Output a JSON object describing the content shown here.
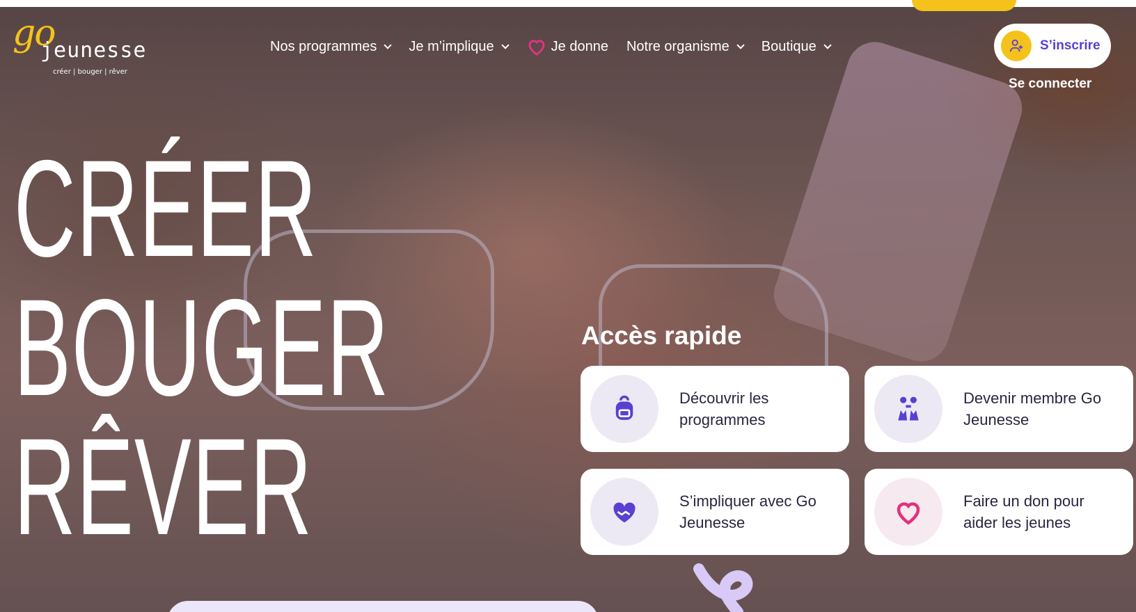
{
  "logo": {
    "go": "go",
    "name": "jeunesse",
    "tagline": "créer | bouger | rêver"
  },
  "nav": {
    "items": [
      {
        "label": "Nos programmes",
        "dropdown": true
      },
      {
        "label": "Je m’implique",
        "dropdown": true
      },
      {
        "label": "Je donne",
        "icon": "heart-icon",
        "dropdown": false
      },
      {
        "label": "Notre organisme",
        "dropdown": true
      },
      {
        "label": "Boutique",
        "dropdown": true
      }
    ]
  },
  "account": {
    "signup_label": "S’inscrire",
    "login_label": "Se connecter"
  },
  "hero": {
    "line1": "CRÉER",
    "line2": "BOUGER",
    "line3": "RÊVER"
  },
  "quick_access": {
    "title": "Accès rapide",
    "cards": [
      {
        "label": "Découvrir les programmes",
        "icon": "backpack-icon"
      },
      {
        "label": "Devenir membre Go Jeunesse",
        "icon": "people-icon"
      },
      {
        "label": "S’impliquer avec Go Jeunesse",
        "icon": "heart-hands-icon"
      },
      {
        "label": "Faire un don pour aider les jeunes",
        "icon": "heart-outline-icon"
      }
    ]
  },
  "colors": {
    "accent": "#5b3fd1",
    "yellow": "#f4c21b",
    "pink": "#e0337f"
  }
}
